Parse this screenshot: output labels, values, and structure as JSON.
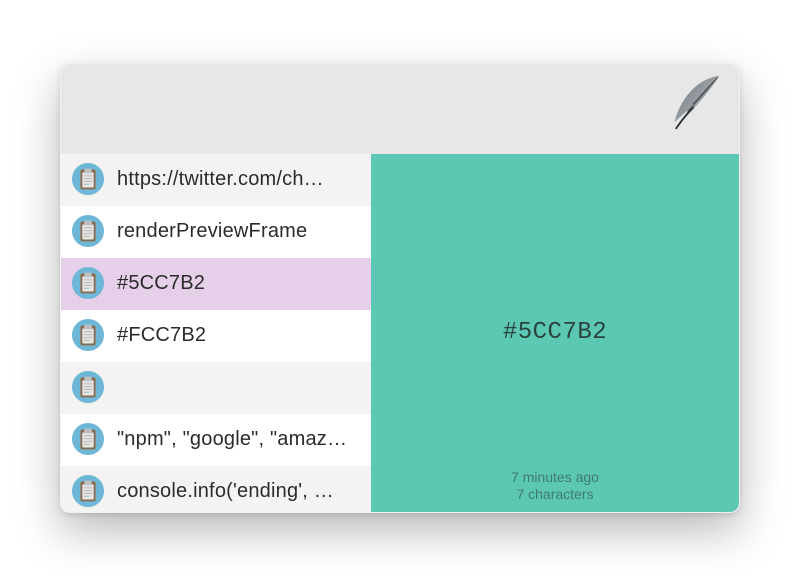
{
  "colors": {
    "preview_bg": "#5CC7B2",
    "selection_bg": "#e6cfe9",
    "icon_ring": "#6fb7d6",
    "icon_board": "#e6e6e6"
  },
  "clips": [
    {
      "text": "https://twitter.com/ch…"
    },
    {
      "text": "renderPreviewFrame"
    },
    {
      "text": "#5CC7B2",
      "selected": true
    },
    {
      "text": "#FCC7B2"
    },
    {
      "text": ""
    },
    {
      "text": "\"npm\", \"google\", \"amaz…"
    },
    {
      "text": "console.info('ending', …"
    }
  ],
  "preview": {
    "content": "#5CC7B2",
    "age": "7 minutes ago",
    "length": "7 characters"
  }
}
